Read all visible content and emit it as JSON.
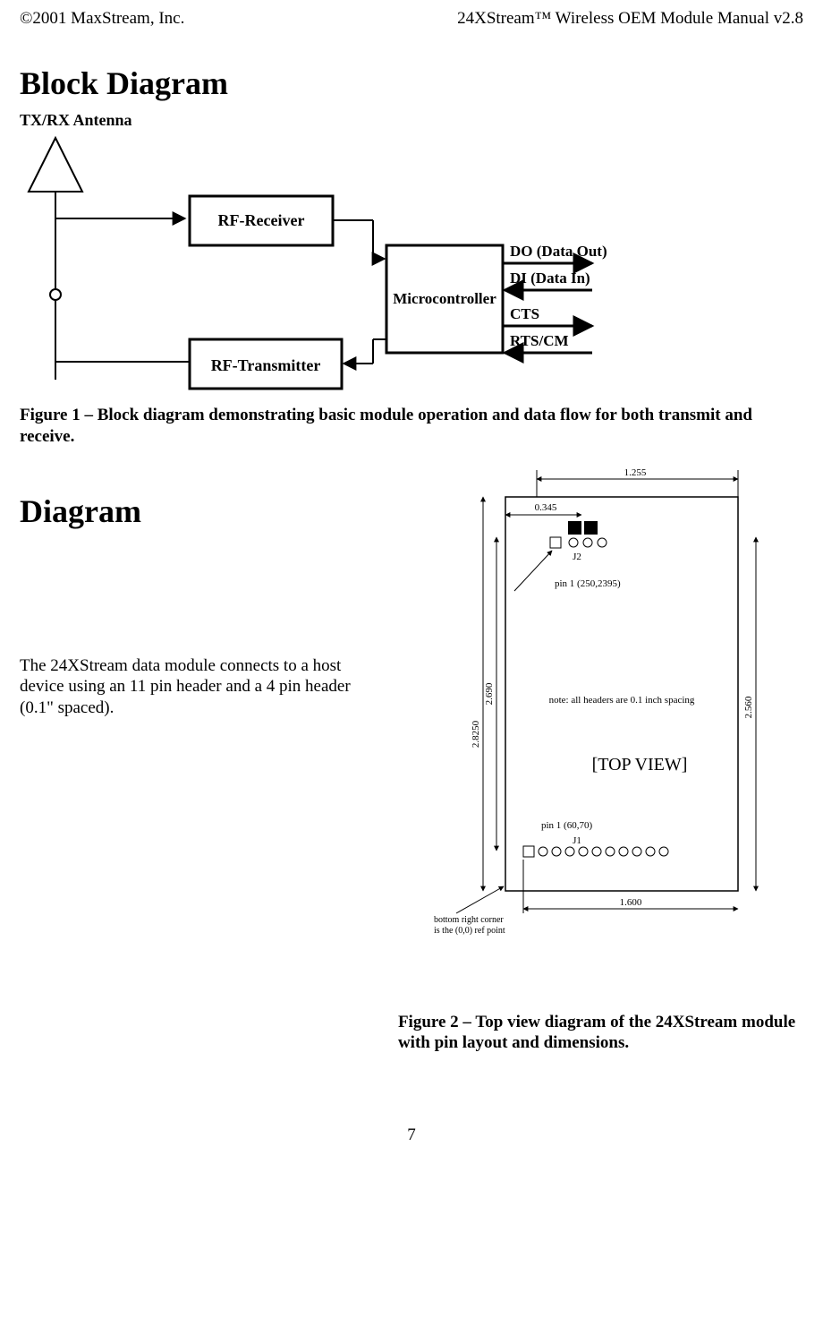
{
  "header": {
    "left": "©2001 MaxStream, Inc.",
    "right": "24XStream™ Wireless OEM Module Manual v2.8"
  },
  "section1": {
    "title": "Block Diagram",
    "caption": "Figure 1 – Block diagram demonstrating basic module operation and data flow for both transmit and receive.",
    "block_labels": {
      "antenna": "TX/RX Antenna",
      "rf_rx": "RF-Receiver",
      "rf_tx": "RF-Transmitter",
      "mcu": "Microcontroller",
      "do": "DO (Data Out)",
      "di": "DI (Data In)",
      "cts": "CTS",
      "rts": "RTS/CM"
    }
  },
  "section2": {
    "title": "Diagram",
    "body": "The 24XStream data module connects to a host device using an 11 pin header and a 4 pin header (0.1\" spaced).",
    "caption": "Figure 2 – Top view diagram of the 24XStream module with pin layout and dimensions.",
    "topview": "[TOP VIEW]",
    "dim_1_255": "1.255",
    "dim_0_345": "0.345",
    "j2": "J2",
    "pin1_j2": "pin 1 (250,2395)",
    "note": "note: all headers are 0.1 inch spacing",
    "dim_2_8250": "2.8250",
    "dim_2_690": "2.690",
    "dim_2_560": "2.560",
    "pin1_j1": "pin 1 (60,70)",
    "j1": "J1",
    "ref": "bottom right corner\nis the (0,0) ref point",
    "dim_1_600": "1.600"
  },
  "page_number": "7"
}
